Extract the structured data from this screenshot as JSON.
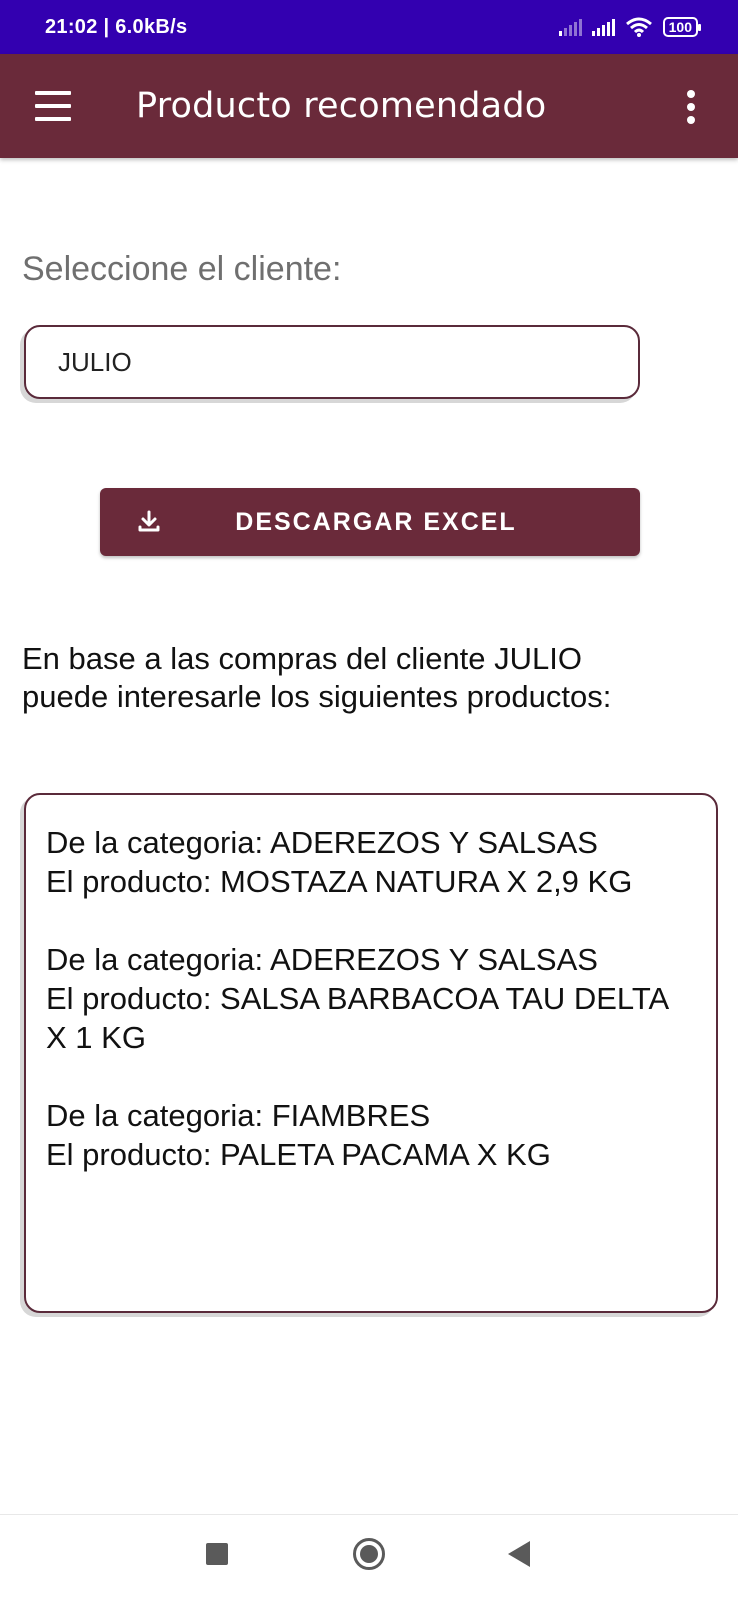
{
  "status_bar": {
    "time_speed": "21:02 | 6.0kB/s",
    "battery": "100"
  },
  "app_bar": {
    "title": "Producto recomendado",
    "icons": [
      "menu-icon",
      "more-vert-icon"
    ]
  },
  "form": {
    "client_label": "Seleccione el cliente:",
    "client_value": "JULIO"
  },
  "download_button": {
    "label": "DESCARGAR EXCEL",
    "icon": "download-icon"
  },
  "intro": {
    "line1": "En base a las compras del cliente JULIO",
    "line2": "puede interesarle los siguientes productos:"
  },
  "recommendations": [
    {
      "category": "De la categoria: ADEREZOS Y SALSAS",
      "product": "El producto: MOSTAZA NATURA X 2,9 KG"
    },
    {
      "category": "De la categoria: ADEREZOS Y SALSAS",
      "product": "El producto: SALSA BARBACOA TAU DELTA X 1 KG"
    },
    {
      "category": "De la categoria: FIAMBRES",
      "product": "El producto: PALETA PACAMA X KG"
    }
  ],
  "colors": {
    "status_bar": "#3300b0",
    "primary": "#6a2a3a",
    "field_border": "#5a2a3a"
  }
}
